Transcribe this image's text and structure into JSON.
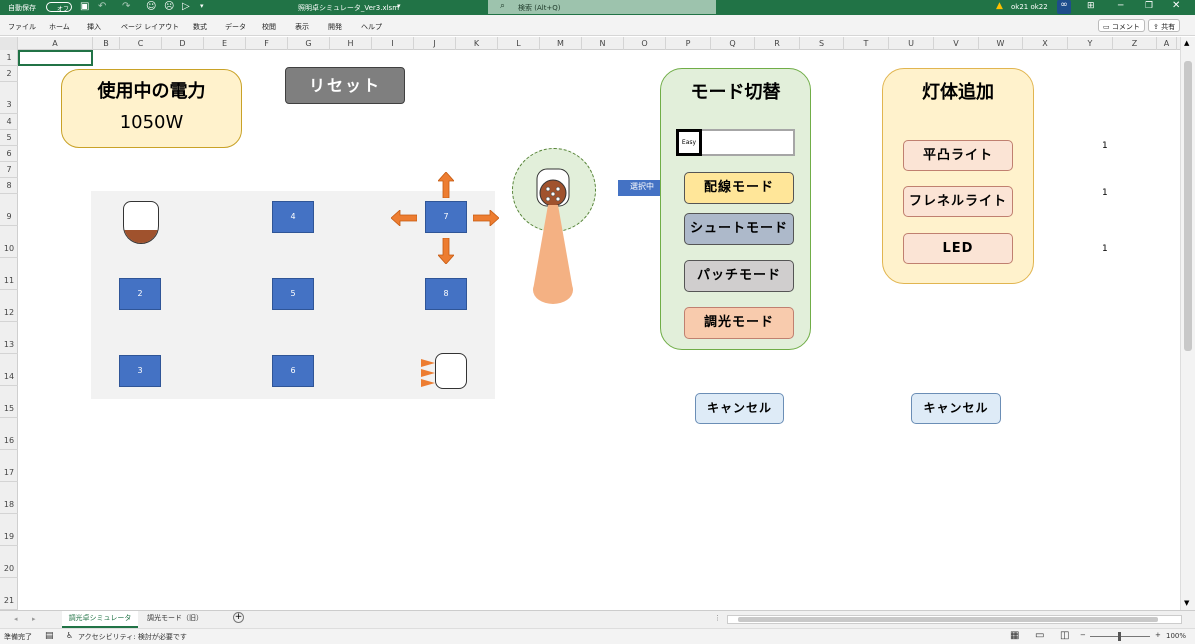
{
  "titlebar": {
    "autosave": "自動保存",
    "autosave_state": "オフ",
    "filename": "照明卓シミュレータ_Ver3.xlsm",
    "search": "検索 (Alt+Q)",
    "user": "ok21 ok22"
  },
  "ribbon": {
    "tabs": [
      "ファイル",
      "ホーム",
      "挿入",
      "ページ レイアウト",
      "数式",
      "データ",
      "校閲",
      "表示",
      "開発",
      "ヘルプ"
    ],
    "comment": "コメント",
    "share": "共有"
  },
  "grid": {
    "name_box": "",
    "columns": [
      "A",
      "B",
      "C",
      "D",
      "E",
      "F",
      "G",
      "H",
      "I",
      "J",
      "K",
      "L",
      "M",
      "N",
      "O",
      "P",
      "Q",
      "R",
      "S",
      "T",
      "U",
      "V",
      "W",
      "X",
      "Y",
      "Z",
      "A"
    ],
    "rows": [
      "1",
      "2",
      "3",
      "4",
      "5",
      "6",
      "7",
      "8",
      "9",
      "10",
      "11",
      "12",
      "13",
      "14",
      "15",
      "16",
      "17",
      "18",
      "19",
      "20",
      "21"
    ]
  },
  "power_panel": {
    "title": "使用中の電力",
    "value": "1050W"
  },
  "reset_button": "リセット",
  "stage": {
    "fixtures": [
      "4",
      "7",
      "2",
      "5",
      "8",
      "3",
      "6"
    ]
  },
  "selecting_label": "選択中",
  "mode_panel": {
    "title": "モード切替",
    "mode_input": "Easy",
    "buttons": [
      "配線モード",
      "シュートモード",
      "パッチモード",
      "調光モード"
    ],
    "cancel": "キャンセル"
  },
  "add_panel": {
    "title": "灯体追加",
    "buttons": [
      "平凸ライト",
      "フレネルライト",
      "LED"
    ],
    "counts": [
      "1",
      "1",
      "1"
    ],
    "cancel": "キャンセル"
  },
  "tabs": {
    "active": "調光卓シミュレータ",
    "other": "調光モード（旧）"
  },
  "status": {
    "ready": "準備完了",
    "accessibility": "アクセシビリティ: 検討が必要です",
    "zoom": "100%"
  },
  "colors": {
    "excel_green": "#217346",
    "power_bg": "#fff2cc",
    "mode_bg": "#e2efda",
    "add_bg": "#fff2cc",
    "fixture_blue": "#4472c4",
    "arrow_orange": "#ed7d31"
  }
}
